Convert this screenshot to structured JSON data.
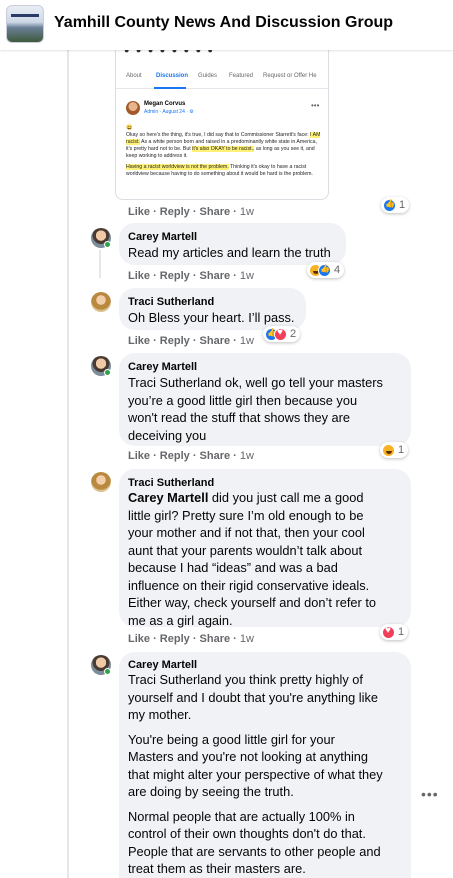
{
  "header": {
    "group_name": "Yamhill County News And Discussion Group"
  },
  "shared_post": {
    "faces_strip": "● ● ● ● ● ● ● ●",
    "tabs": [
      "About",
      "Discussion",
      "Guides",
      "Featured",
      "Request or Offer He"
    ],
    "author": "Megan Corvus",
    "meta": "Admin · August 24 · ⚙",
    "more": "•••",
    "body_1": "😄",
    "body_2": "Okay so here's the thing, it's true, I did say that to Commissioner Starrett's face: ",
    "body_hl_1": "I AM racist.",
    "body_3": " As a white person born and raised in a predominantly white state in America, it's pretty hard not to be. But ",
    "body_hl_2": "it's also OKAY to be racist..",
    "body_4": " as long as you see it, and keep working to address it.",
    "body_hl_3": "Having a racist worldview is not the problem.",
    "body_5": " Thinking it's okay to have a racist worldview because having to do something about it would be hard is the problem."
  },
  "labels": {
    "like": "Like",
    "reply": "Reply",
    "share": "Share",
    "sep": " · "
  },
  "comments": [
    {
      "time": "1w",
      "reaction_count": "1"
    },
    {
      "name": "Carey Martell",
      "text": "Read my articles and learn the truth",
      "time": "1w",
      "reaction_count": "4"
    },
    {
      "name": "Traci Sutherland",
      "text": "Oh Bless your heart. I’ll pass.",
      "time": "1w",
      "reaction_count": "2"
    },
    {
      "name": "Carey Martell",
      "lines": [
        "Traci Sutherland ok, well go tell your masters",
        "you’re a good little girl then because you",
        "won't read the stuff that shows they are",
        "deceiving you"
      ],
      "time": "1w",
      "reaction_count": "1"
    },
    {
      "name": "Traci Sutherland",
      "mention": "Carey Martell",
      "lines": [
        " did you just call me a good",
        "little girl? Pretty sure I’m old enough to be",
        "your mother and if not that, then your cool",
        "aunt that your parents wouldn’t talk about",
        "because I had “ideas” and was a bad",
        "influence on their rigid conservative ideals.",
        "Either way, check yourself and don’t refer to",
        "me as a girl again."
      ],
      "time": "1w",
      "reaction_count": "1"
    },
    {
      "name": "Carey Martell",
      "para1": [
        "Traci Sutherland you think pretty highly of",
        "yourself and I doubt that you're anything like",
        "my mother."
      ],
      "para2": [
        "You're being a good little girl for your",
        "Masters and you're not looking at anything",
        "that might alter your perspective of what they",
        "are doing by seeing the truth."
      ],
      "para3": [
        "Normal people that are actually 100% in",
        "control of their own thoughts don't do that.",
        "People that are servants to other people and",
        "treat them as their masters are."
      ]
    }
  ],
  "more_options": "•••"
}
